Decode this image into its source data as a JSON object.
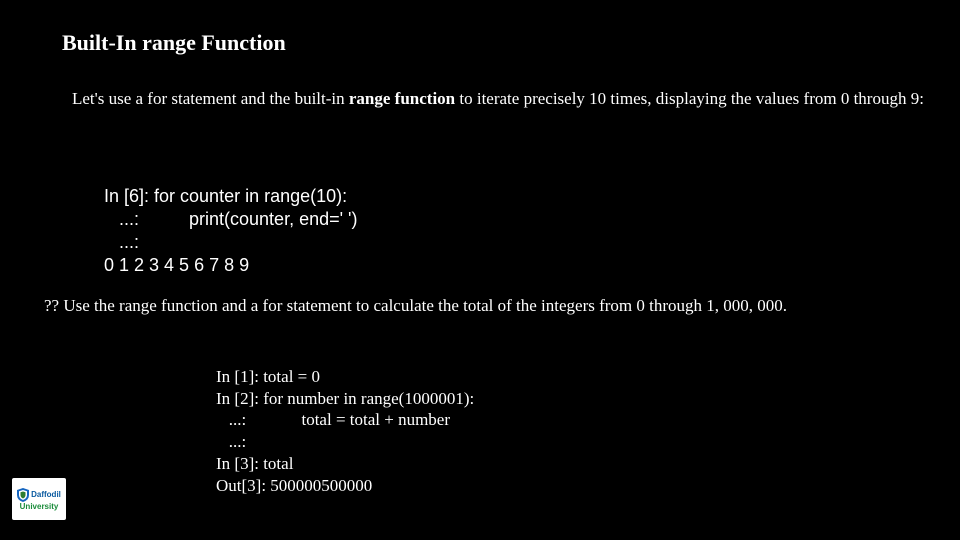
{
  "title": "Built-In range Function",
  "intro": {
    "pre": "Let's use a for statement and the built-in ",
    "bold": "range function",
    "post": " to iterate precisely 10 times, displaying the values from 0 through 9:"
  },
  "code1": {
    "l1": "In [6]: for counter in range(10):",
    "l2": "   ...:          print(counter, end=' ')",
    "l3": "   ...:",
    "l4": "0 1 2 3 4 5 6 7 8 9"
  },
  "question": "?? Use the range function and a for statement to calculate the total of the integers from 0 through 1, 000, 000.",
  "code2": {
    "l1": "In [1]: total = 0",
    "l2": "In [2]: for number in range(1000001):",
    "l3": "   ...:             total = total + number",
    "l4": "   ...:",
    "l5": "In [3]: total",
    "l6": "Out[3]: 500000500000"
  },
  "logo": {
    "line1": "Daffodil",
    "line2": "University"
  }
}
